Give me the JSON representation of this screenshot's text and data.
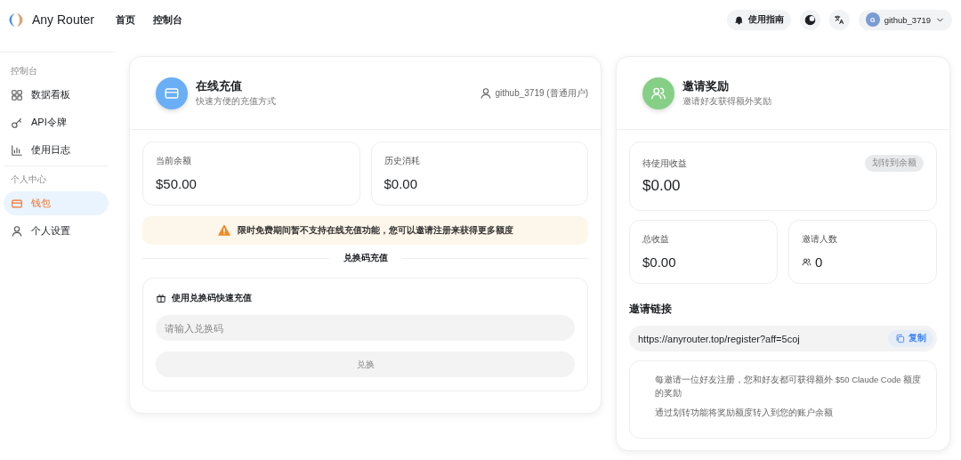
{
  "header": {
    "brand": "Any Router",
    "nav": [
      {
        "label": "首页",
        "selected": false
      },
      {
        "label": "控制台",
        "selected": false
      }
    ],
    "guide": "使用指南",
    "user": {
      "initial": "G",
      "name": "github_3719"
    }
  },
  "sidebar": {
    "sections": [
      {
        "title": "控制台",
        "items": [
          {
            "label": "数据看板",
            "kind": "grid",
            "selected": false
          },
          {
            "label": "API令牌",
            "kind": "key",
            "selected": false
          },
          {
            "label": "使用日志",
            "kind": "chart",
            "selected": false
          }
        ]
      },
      {
        "title": "个人中心",
        "items": [
          {
            "label": "钱包",
            "kind": "wallet",
            "selected": true
          },
          {
            "label": "个人设置",
            "kind": "user",
            "selected": false
          }
        ]
      }
    ]
  },
  "recharge": {
    "title": "在线充值",
    "subtitle": "快速方便的充值方式",
    "user": "github_3719 (普通用户)",
    "stats": [
      {
        "label": "当前余额",
        "value": "$50.00"
      },
      {
        "label": "历史消耗",
        "value": "$0.00"
      }
    ],
    "notice": "限时免费期间暂不支持在线充值功能，您可以邀请注册来获得更多额度",
    "divider": "兑换码充值",
    "redeem": {
      "title": "使用兑换码快速充值",
      "placeholder": "请输入兑换码",
      "button": "兑换"
    }
  },
  "invite": {
    "title": "邀请奖励",
    "subtitle": "邀请好友获得额外奖励",
    "pending": {
      "label": "待使用收益",
      "value": "$0.00",
      "action": "划转到余额"
    },
    "stats": [
      {
        "label": "总收益",
        "value": "$0.00",
        "kind": "money"
      },
      {
        "label": "邀请人数",
        "value": "0",
        "kind": "count"
      }
    ],
    "link_title": "邀请链接",
    "link": "https://anyrouter.top/register?aff=5coj",
    "copy": "复制",
    "notes": [
      "每邀请一位好友注册，您和好友都可获得额外 $50 Claude Code 额度的奖励",
      "通过划转功能将奖励额度转入到您的账户余额"
    ]
  }
}
